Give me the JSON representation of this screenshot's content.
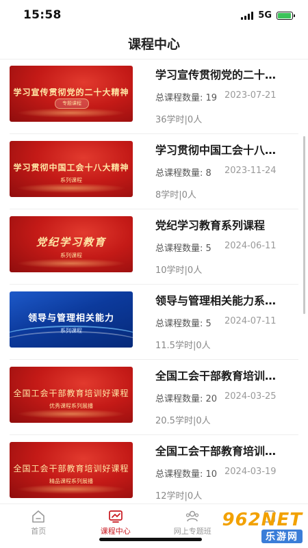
{
  "status_bar": {
    "time": "15:58",
    "network": "5G",
    "battery_fill": 0.85
  },
  "header": {
    "title": "课程中心"
  },
  "courses": [
    {
      "title": "学习宣传贯彻党的二十…",
      "count": "总课程数量: 19",
      "date": "2023-07-21",
      "hours": "36学时|0人",
      "thumb_title": "学习宣传贯彻党的二十大精神",
      "thumb_sub": "专题课程",
      "thumb_style": "red"
    },
    {
      "title": "学习贯彻中国工会十八…",
      "count": "总课程数量: 8",
      "date": "2023-11-24",
      "hours": "8学时|0人",
      "thumb_title": "学习贯彻中国工会十八大精神",
      "thumb_sub": "系列课程",
      "thumb_style": "red"
    },
    {
      "title": "党纪学习教育系列课程",
      "count": "总课程数量: 5",
      "date": "2024-06-11",
      "hours": "10学时|0人",
      "thumb_title": "党纪学习教育",
      "thumb_sub": "系列课程",
      "thumb_style": "red"
    },
    {
      "title": "领导与管理相关能力系…",
      "count": "总课程数量: 5",
      "date": "2024-07-11",
      "hours": "11.5学时|0人",
      "thumb_title": "领导与管理相关能力",
      "thumb_sub": "系列课程",
      "thumb_style": "blue"
    },
    {
      "title": "全国工会干部教育培训…",
      "count": "总课程数量: 20",
      "date": "2024-03-25",
      "hours": "20.5学时|0人",
      "thumb_title": "全国工会干部教育培训好课程",
      "thumb_sub": "优秀课程系列展播",
      "thumb_style": "red"
    },
    {
      "title": "全国工会干部教育培训…",
      "count": "总课程数量: 10",
      "date": "2024-03-19",
      "hours": "12学时|0人",
      "thumb_title": "全国工会干部教育培训好课程",
      "thumb_sub": "精品课程系列展播",
      "thumb_style": "red"
    }
  ],
  "tabbar": {
    "items": [
      {
        "label": "首页",
        "icon": "home-icon"
      },
      {
        "label": "课程中心",
        "icon": "course-center-icon"
      },
      {
        "label": "网上专题班",
        "icon": "people-icon"
      },
      {
        "label": "",
        "icon": "profile-icon"
      }
    ],
    "active_color": "#c8161d"
  },
  "watermark": {
    "main": "962NET",
    "sub": "乐游网"
  },
  "colors": {
    "accent": "#c8161d",
    "thumb_red": "#c41a17",
    "thumb_blue": "#0c3a9c"
  }
}
